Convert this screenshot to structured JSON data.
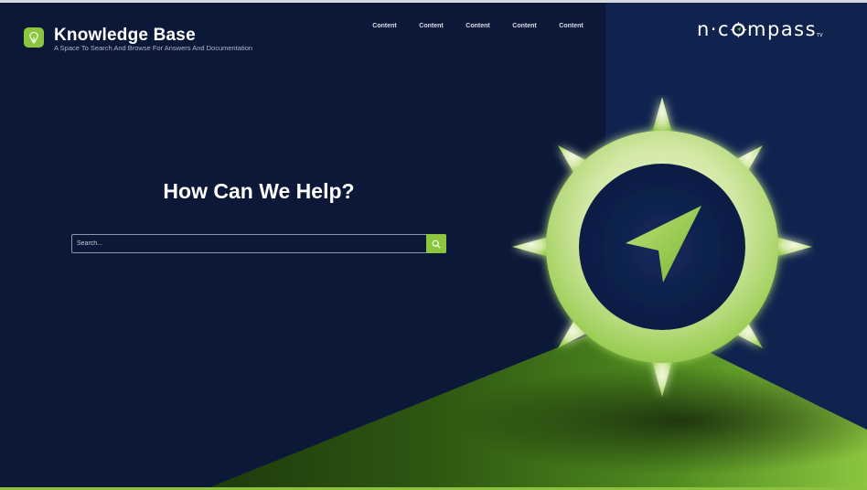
{
  "header": {
    "title": "Knowledge Base",
    "subtitle": "A Space To Search And Browse For Answers And Documentation",
    "logo_icon": "lightbulb-icon"
  },
  "nav": {
    "items": [
      {
        "label": "Content"
      },
      {
        "label": "Content"
      },
      {
        "label": "Content"
      },
      {
        "label": "Content"
      },
      {
        "label": "Content"
      }
    ]
  },
  "partner": {
    "prefix": "n·c",
    "suffix": "mpass",
    "superscript": "TV"
  },
  "hero": {
    "title": "How Can We Help?"
  },
  "search": {
    "placeholder": "Search...",
    "value": "",
    "button_icon": "search-icon"
  },
  "colors": {
    "background": "#0b1838",
    "panel": "#10234f",
    "accent": "#8cc63f",
    "text": "#ffffff"
  }
}
